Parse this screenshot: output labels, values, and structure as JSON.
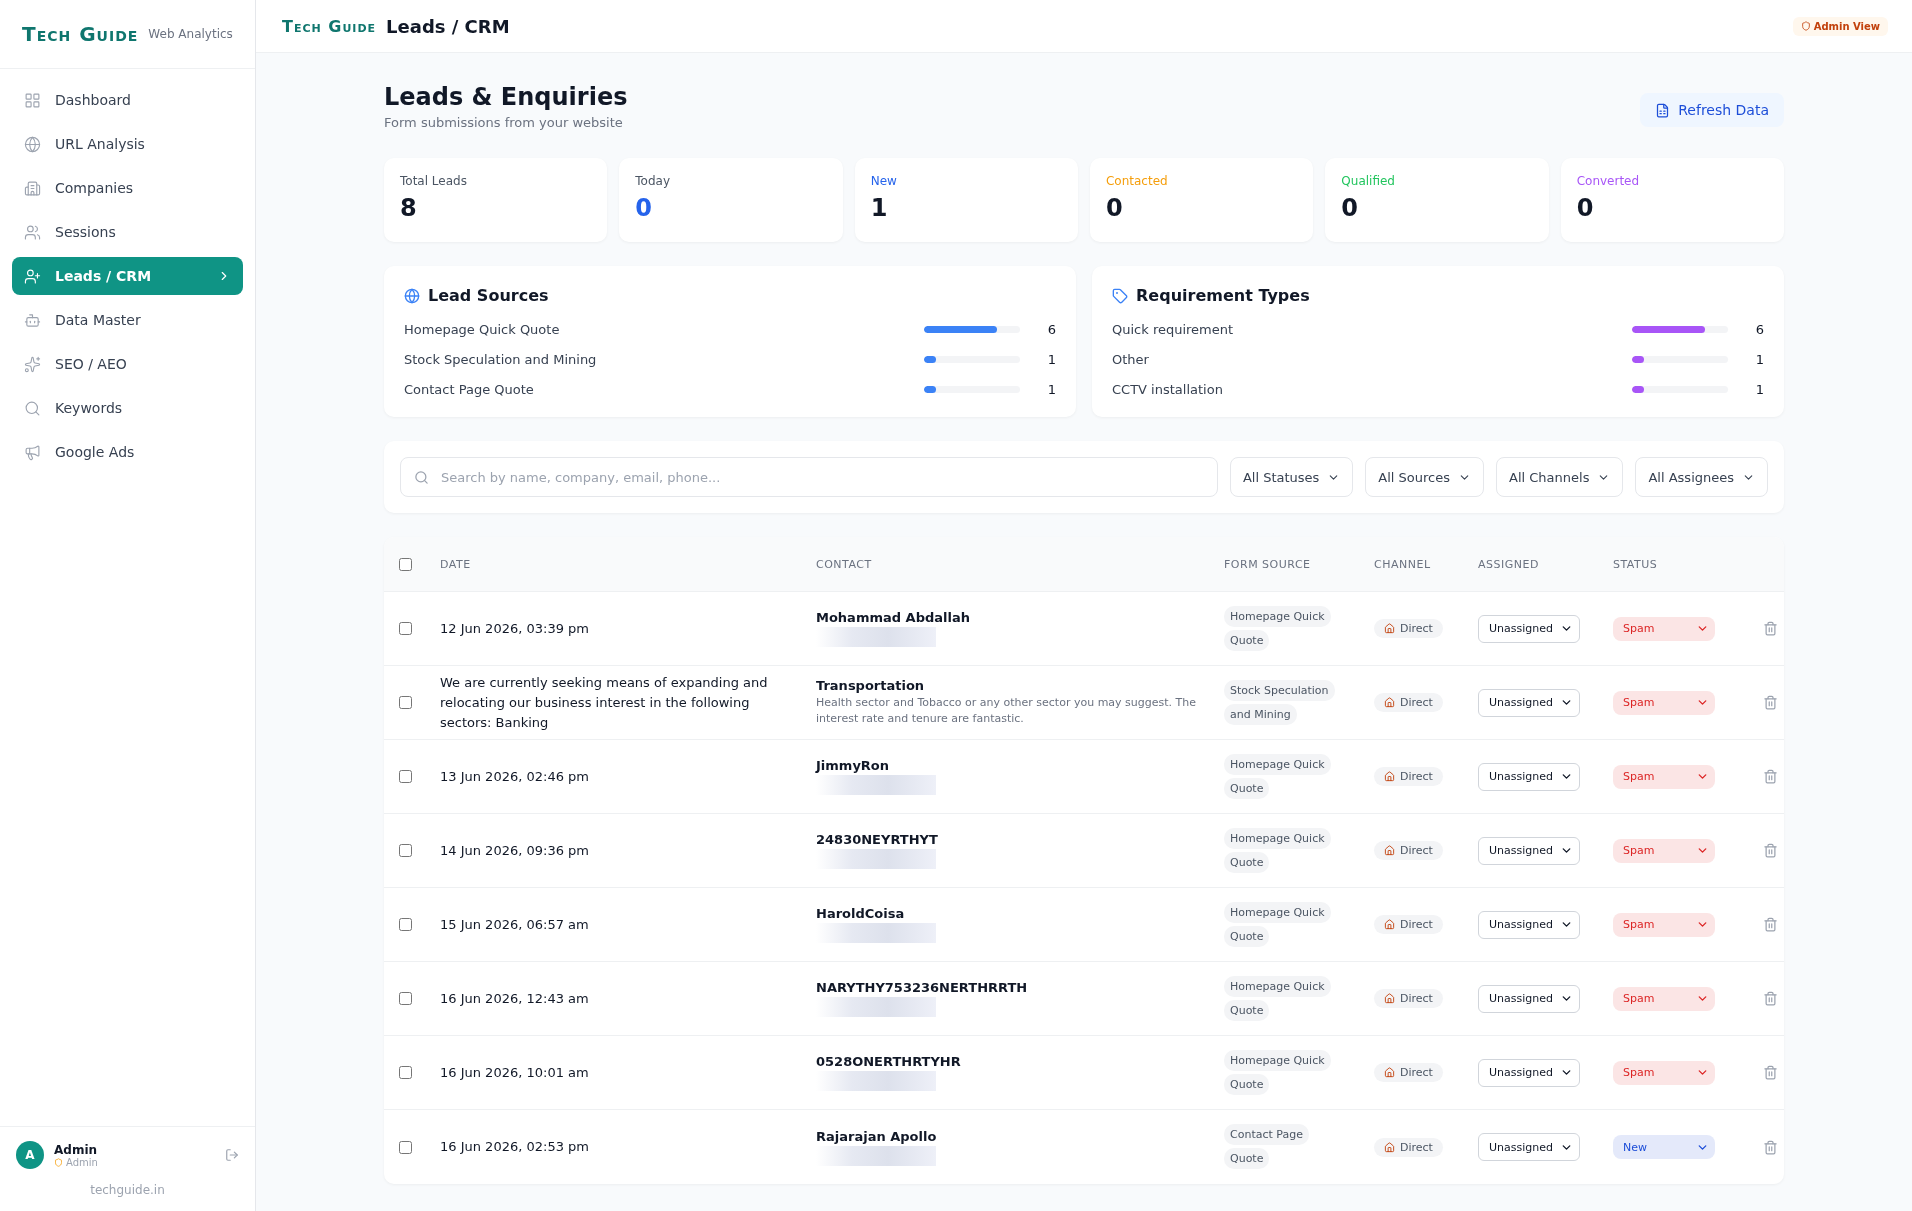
{
  "sidebar": {
    "logo": "Tech Guide",
    "tagline": "Web Analytics",
    "items": [
      {
        "label": "Dashboard",
        "selected": false
      },
      {
        "label": "URL Analysis",
        "selected": false
      },
      {
        "label": "Companies",
        "selected": false
      },
      {
        "label": "Sessions",
        "selected": false
      },
      {
        "label": "Leads / CRM",
        "selected": true
      },
      {
        "label": "Data Master",
        "selected": false
      },
      {
        "label": "SEO / AEO",
        "selected": false
      },
      {
        "label": "Keywords",
        "selected": false
      },
      {
        "label": "Google Ads",
        "selected": false
      }
    ],
    "user": {
      "initial": "A",
      "name": "Admin",
      "role": "Admin"
    },
    "footer": "techguide.in"
  },
  "header": {
    "logo": "Tech Guide",
    "title": "Leads / CRM",
    "badge": "Admin View"
  },
  "page": {
    "title": "Leads & Enquiries",
    "subtitle": "Form submissions from your website",
    "refresh_button": "Refresh Data"
  },
  "stats": [
    {
      "label": "Total Leads",
      "value": "8",
      "kind": "total"
    },
    {
      "label": "Today",
      "value": "0",
      "kind": "today"
    },
    {
      "label": "New",
      "value": "1",
      "kind": "new"
    },
    {
      "label": "Contacted",
      "value": "0",
      "kind": "contacted"
    },
    {
      "label": "Qualified",
      "value": "0",
      "kind": "qualified"
    },
    {
      "label": "Converted",
      "value": "0",
      "kind": "converted"
    }
  ],
  "breakdowns": [
    {
      "title": "Lead Sources",
      "color": "#3b82f6",
      "items": [
        {
          "label": "Homepage Quick Quote",
          "level": 0.76,
          "count": "6"
        },
        {
          "label": "Stock Speculation and Mining",
          "level": 0.12,
          "count": "1"
        },
        {
          "label": "Contact Page Quote",
          "level": 0.12,
          "count": "1"
        }
      ]
    },
    {
      "title": "Requirement Types",
      "color": "#a855f7",
      "items": [
        {
          "label": "Quick requirement",
          "level": 0.76,
          "count": "6"
        },
        {
          "label": "Other",
          "level": 0.12,
          "count": "1"
        },
        {
          "label": "CCTV installation",
          "level": 0.12,
          "count": "1"
        }
      ]
    }
  ],
  "filters": {
    "search_placeholder": "Search by name, company, email, phone...",
    "dropdowns": [
      "All Statuses",
      "All Sources",
      "All Channels",
      "All Assignees"
    ]
  },
  "table": {
    "select_all_checked": false,
    "columns": [
      "DATE",
      "CONTACT",
      "FORM SOURCE",
      "CHANNEL",
      "ASSIGNED",
      "STATUS"
    ],
    "rows": [
      {
        "checked": false,
        "date": "12 Jun 2026, 03:39 pm",
        "contact": "Mohammad Abdallah",
        "redacted": true,
        "source": "Homepage Quick Quote",
        "channel": "Direct",
        "assigned": "Unassigned",
        "status": {
          "label": "Spam",
          "color": "#dc2626"
        }
      },
      {
        "checked": false,
        "date": "We are currently seeking means of expanding and relocating our business interest in the following sectors: Banking",
        "contact": "Transportation",
        "note": "Health sector and Tobacco or any other sector you may suggest. The interest rate and tenure are fantastic.",
        "source": "Stock Speculation and Mining",
        "channel": "Direct",
        "assigned": "Unassigned",
        "status": {
          "label": "Spam",
          "color": "#dc2626"
        }
      },
      {
        "checked": false,
        "date": "13 Jun 2026, 02:46 pm",
        "contact": "JimmyRon",
        "redacted": true,
        "source": "Homepage Quick Quote",
        "channel": "Direct",
        "assigned": "Unassigned",
        "status": {
          "label": "Spam",
          "color": "#dc2626"
        }
      },
      {
        "checked": false,
        "date": "14 Jun 2026, 09:36 pm",
        "contact": "24830NEYRTHYT",
        "redacted": true,
        "source": "Homepage Quick Quote",
        "channel": "Direct",
        "assigned": "Unassigned",
        "status": {
          "label": "Spam",
          "color": "#dc2626"
        }
      },
      {
        "checked": false,
        "date": "15 Jun 2026, 06:57 am",
        "contact": "HaroldCoisa",
        "redacted": true,
        "source": "Homepage Quick Quote",
        "channel": "Direct",
        "assigned": "Unassigned",
        "status": {
          "label": "Spam",
          "color": "#dc2626"
        }
      },
      {
        "checked": false,
        "date": "16 Jun 2026, 12:43 am",
        "contact": "NARYTHY753236NERTHRRTH",
        "redacted": true,
        "source": "Homepage Quick Quote",
        "channel": "Direct",
        "assigned": "Unassigned",
        "status": {
          "label": "Spam",
          "color": "#dc2626"
        }
      },
      {
        "checked": false,
        "date": "16 Jun 2026, 10:01 am",
        "contact": "0528ONERTHRTYHR",
        "redacted": true,
        "source": "Homepage Quick Quote",
        "channel": "Direct",
        "assigned": "Unassigned",
        "status": {
          "label": "Spam",
          "color": "#dc2626"
        }
      },
      {
        "checked": false,
        "date": "16 Jun 2026, 02:53 pm",
        "contact": "Rajarajan Apollo",
        "redacted": true,
        "source": "Contact Page Quote",
        "channel": "Direct",
        "assigned": "Unassigned",
        "status": {
          "label": "New",
          "color": "#1d4ed8"
        }
      }
    ]
  }
}
